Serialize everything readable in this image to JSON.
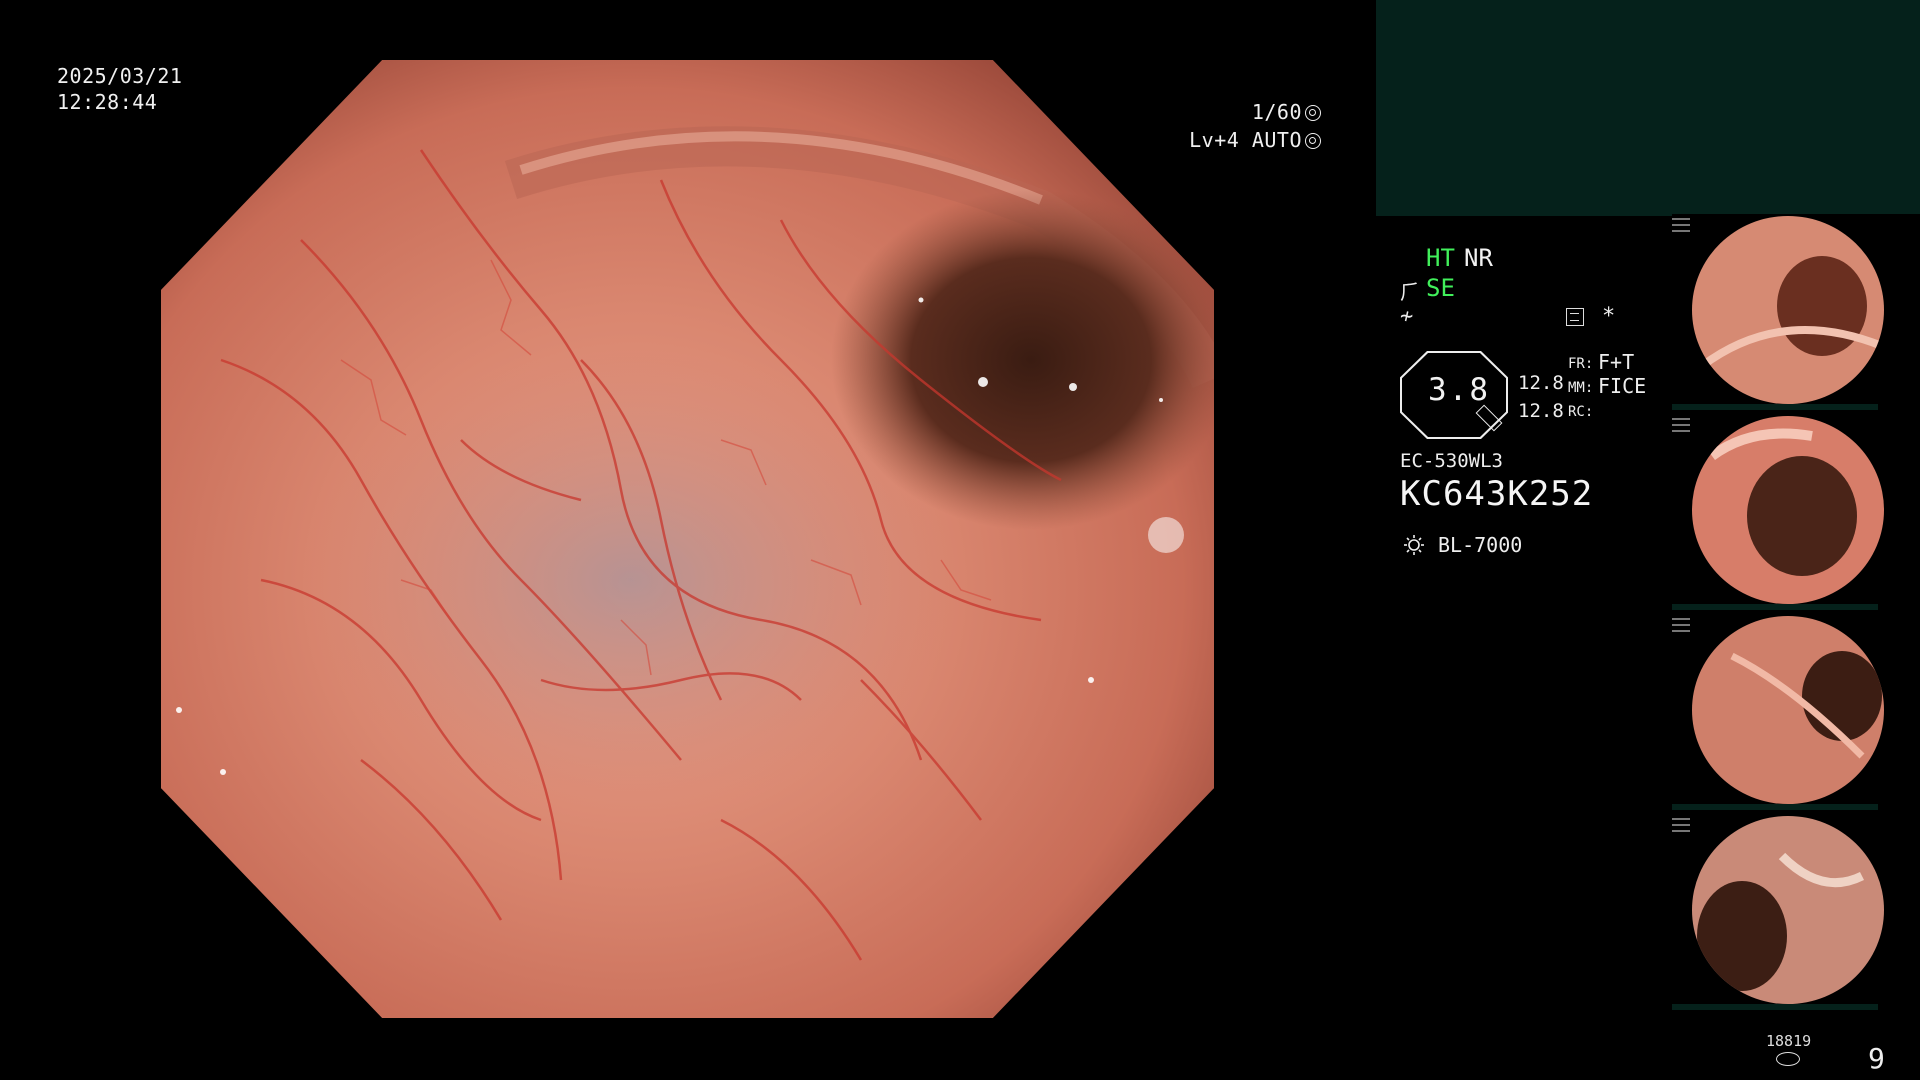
{
  "overlay": {
    "date": "2025/03/21",
    "time": "12:28:44",
    "shutter": "1/60",
    "gain": "Lv+4 AUTO"
  },
  "status": {
    "ht": "HT",
    "nr": "NR",
    "se": "SE",
    "active_color": "#41f05b",
    "star": "*"
  },
  "scope": {
    "value": "3.8",
    "num1": "12.8",
    "num2": "12.8",
    "fr_label": "FR:",
    "fr_value": "F+T",
    "mm_label": "MM:",
    "mm_value": "FICE",
    "rc_label": "RC:",
    "model": "EC-530WL3",
    "serial": "KC643K252",
    "light": "BL-7000"
  },
  "footer": {
    "counter": "18819",
    "page": "9"
  },
  "colors": {
    "panel_teal": "#05211b",
    "tissue": "#d77f6b",
    "vessel": "#c8372e"
  },
  "thumbnails": [
    {
      "label": "captured-image-1"
    },
    {
      "label": "captured-image-2"
    },
    {
      "label": "captured-image-3"
    },
    {
      "label": "captured-image-4"
    }
  ]
}
